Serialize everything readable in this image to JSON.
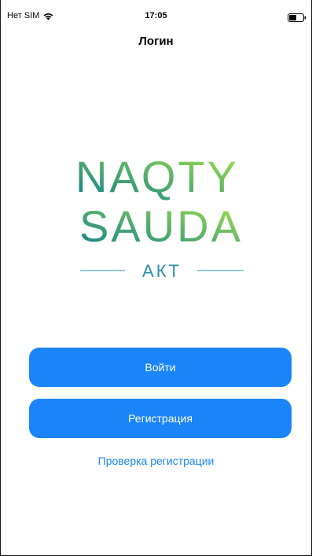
{
  "status_bar": {
    "carrier": "Нет SIM",
    "time": "17:05",
    "wifi_icon": "wifi-icon",
    "battery_icon": "battery-icon"
  },
  "nav": {
    "title": "Логин"
  },
  "logo": {
    "line1": "NAQTY",
    "line2": "SAUDA",
    "subtitle": "АКТ",
    "gradient_start": "#0d7f8a",
    "gradient_end": "#a6e24a",
    "subtitle_color": "#2a8fa6"
  },
  "actions": {
    "login_label": "Войти",
    "register_label": "Регистрация",
    "check_registration_label": "Проверка регистрации"
  },
  "colors": {
    "accent": "#1a84f8",
    "background": "#ffffff"
  }
}
